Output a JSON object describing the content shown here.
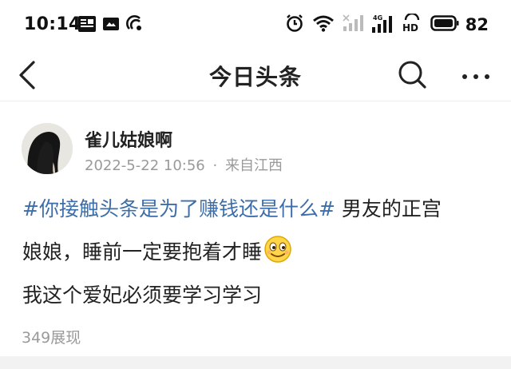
{
  "status_bar": {
    "time": "10:14",
    "battery": "82",
    "icons": [
      "toutiao-app-icon",
      "message-icon",
      "hotspot-icon",
      "alarm-icon",
      "wifi-icon",
      "signal-icon",
      "4g-signal-icon",
      "hd-icon",
      "battery-icon"
    ]
  },
  "nav": {
    "title": "今日头条",
    "icons": [
      "back-arrow-icon",
      "search-icon",
      "more-icon"
    ]
  },
  "post": {
    "author": "雀儿姑娘啊",
    "date": "2022-5-22 10:56",
    "separator": "·",
    "source": "来自江西",
    "hashtag": "#你接触头条是为了赚钱还是什么#",
    "body_line1_tail": " 男友的正宫",
    "body_line2": "娘娘，睡前一定要抱着才睡",
    "body_line3": "我这个爱妃必须要学习学习",
    "emoji": "smile-emoji",
    "views": "349展现"
  },
  "colors": {
    "hashtag": "#3d6ea9",
    "meta_gray": "#9a9a9a",
    "text": "#222222"
  }
}
